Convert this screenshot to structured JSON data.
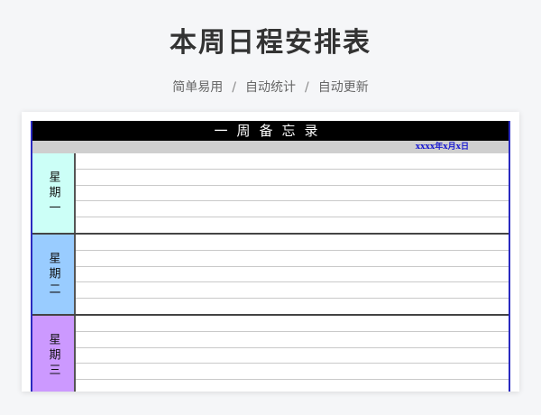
{
  "page": {
    "title": "本周日程安排表",
    "tags": [
      "简单易用",
      "自动统计",
      "自动更新"
    ],
    "separator": "/"
  },
  "sheet": {
    "header": "一周备忘录",
    "date": "xxxx年x月x日",
    "days": [
      {
        "label": "星期一",
        "color": "#ccfff7"
      },
      {
        "label": "星期二",
        "color": "#99ccff"
      },
      {
        "label": "星期三",
        "color": "#cc99ff"
      }
    ]
  }
}
